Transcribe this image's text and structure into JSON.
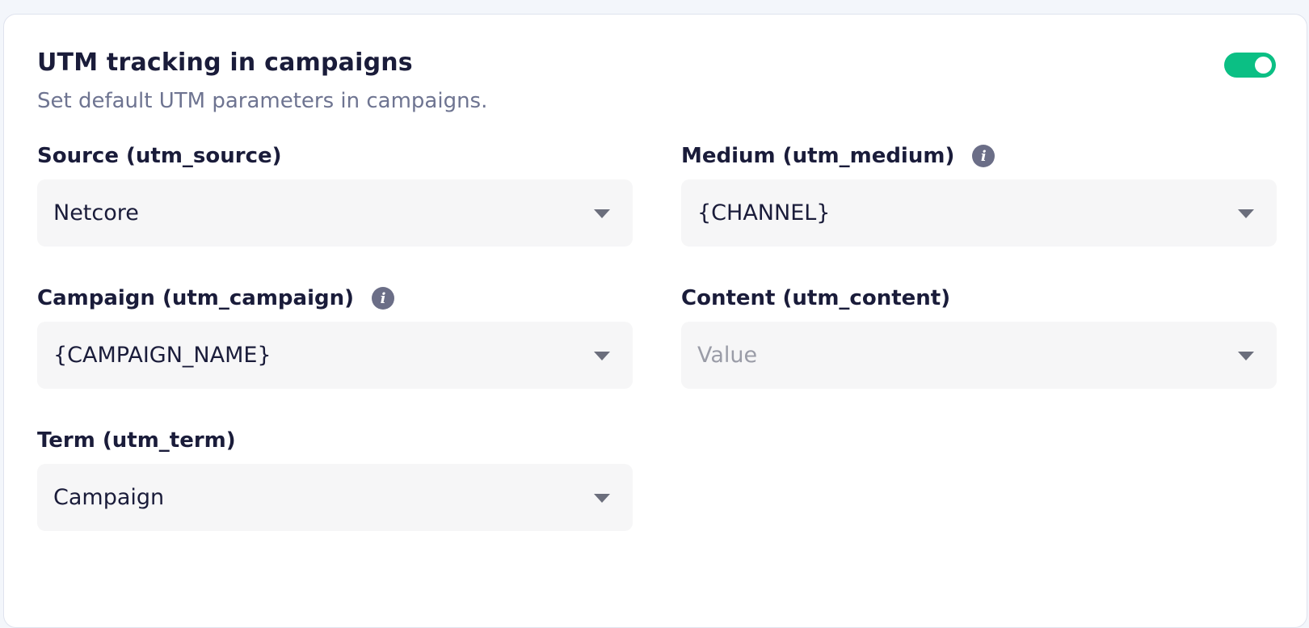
{
  "card": {
    "title": "UTM tracking in campaigns",
    "subtitle": "Set default UTM parameters in campaigns.",
    "toggle_enabled": true,
    "accent_color": "#0bbf84"
  },
  "fields": {
    "source": {
      "label": "Source (utm_source)",
      "value": "Netcore",
      "has_info": false
    },
    "medium": {
      "label": "Medium (utm_medium)",
      "value": "{CHANNEL}",
      "has_info": true
    },
    "campaign": {
      "label": "Campaign (utm_campaign)",
      "value": "{CAMPAIGN_NAME}",
      "has_info": true
    },
    "content": {
      "label": "Content (utm_content)",
      "value": "",
      "placeholder": "Value",
      "has_info": false
    },
    "term": {
      "label": "Term (utm_term)",
      "value": "Campaign",
      "has_info": false
    }
  },
  "icons": {
    "info": "info-icon",
    "dropdown": "chevron-down-icon"
  }
}
